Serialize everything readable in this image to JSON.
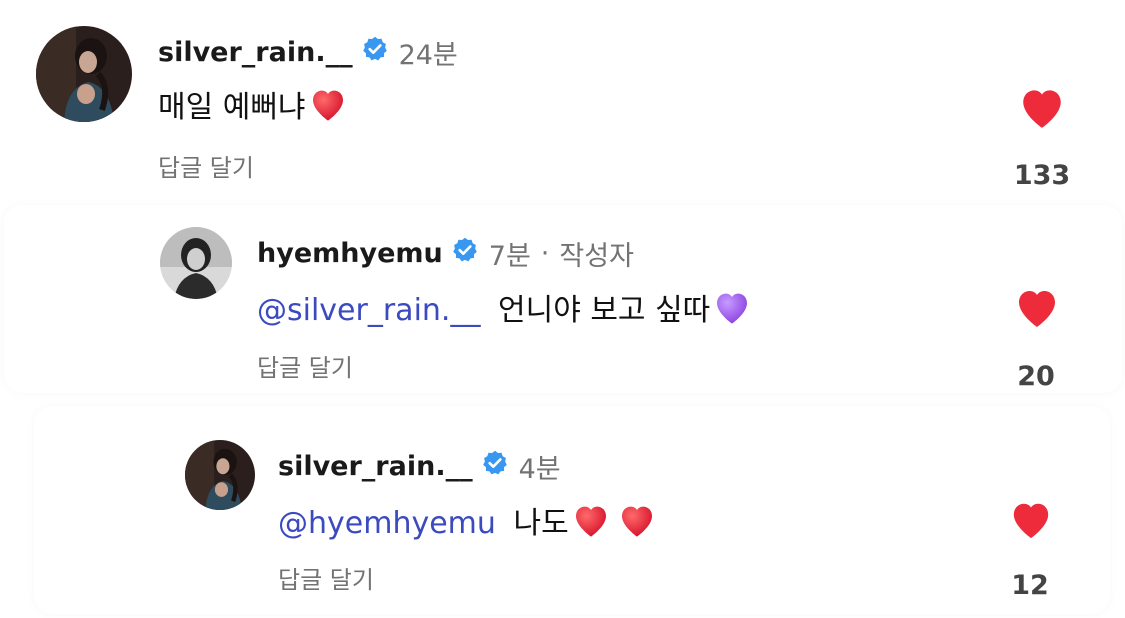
{
  "comments": [
    {
      "username": "silver_rain.__",
      "time": "24분",
      "text": "매일 예뻐냐",
      "emoji": "red-heart",
      "reply": "답글 달기",
      "likes": "133"
    },
    {
      "username": "hyemhyemu",
      "time": "7분",
      "separator": "·",
      "author_tag": "작성자",
      "mention": "@silver_rain.__",
      "text": "언니야 보고 싶따",
      "emoji": "purple-heart",
      "reply": "답글 달기",
      "likes": "20"
    },
    {
      "username": "silver_rain.__",
      "time": "4분",
      "mention": "@hyemhyemu",
      "text": "나도",
      "emoji": "red-heart x2",
      "reply": "답글 달기",
      "likes": "12"
    }
  ],
  "colors": {
    "like_red": "#ee2b3b",
    "verified_blue": "#3897f0",
    "mention_blue": "#3b4bbf",
    "muted_gray": "#737373",
    "purple_heart": "#9b5de5"
  }
}
